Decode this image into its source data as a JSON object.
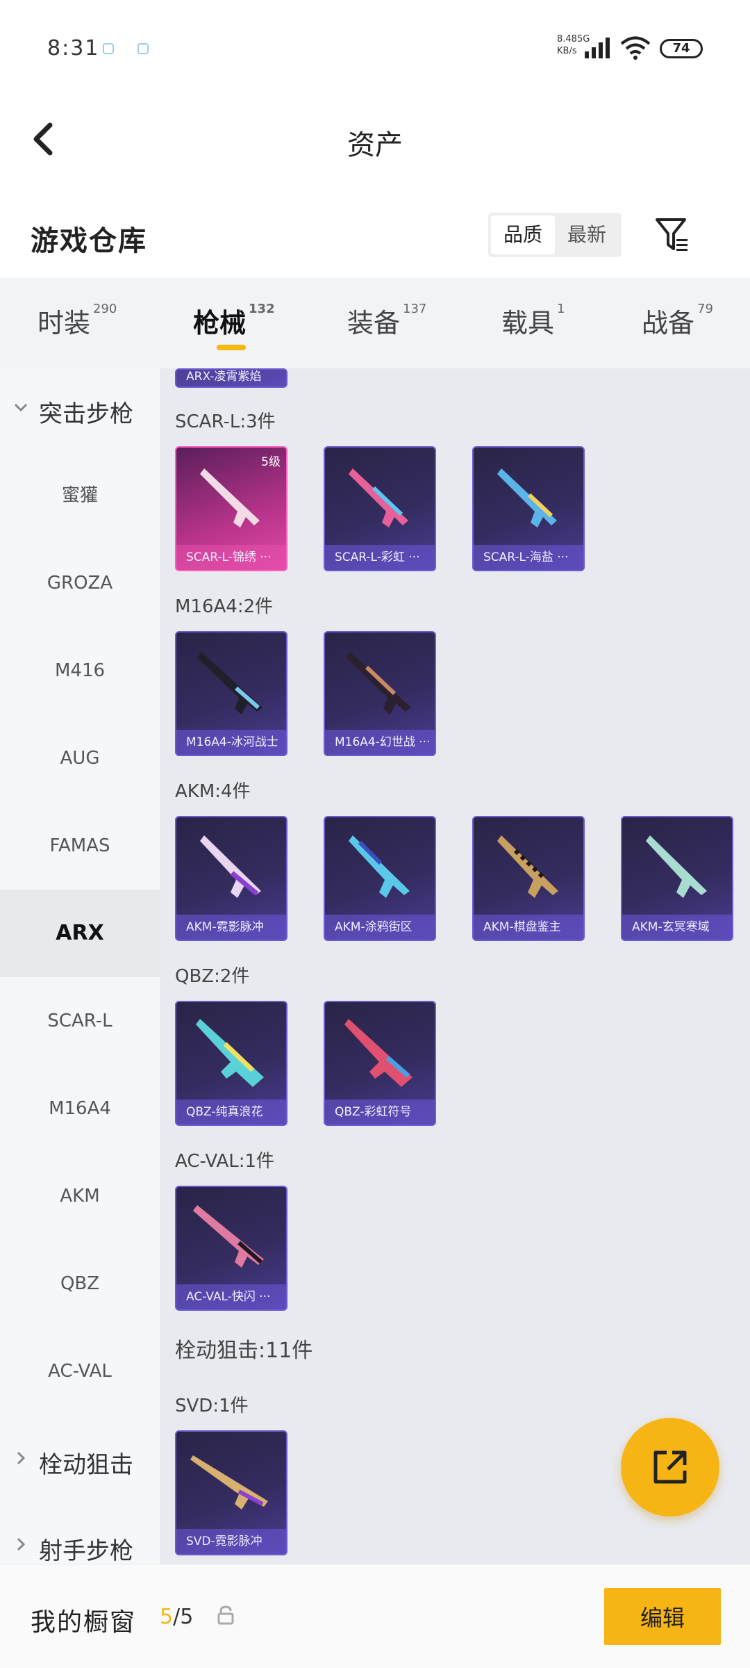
{
  "status": {
    "time": "8:31",
    "net_speed": "8.48",
    "net_unit": "KB/s",
    "net_type": "5G",
    "battery": "74"
  },
  "nav": {
    "title": "资产"
  },
  "warehouse": {
    "title": "游戏仓库",
    "sort_options": [
      "品质",
      "最新"
    ],
    "active_sort": "品质"
  },
  "tabs": [
    {
      "label": "时装",
      "count": "290"
    },
    {
      "label": "枪械",
      "count": "132"
    },
    {
      "label": "装备",
      "count": "137"
    },
    {
      "label": "载具",
      "count": "1"
    },
    {
      "label": "战备",
      "count": "79"
    }
  ],
  "sidebar": {
    "groups": [
      {
        "label": "突击步枪"
      },
      {
        "label": "栓动狙击"
      },
      {
        "label": "射手步枪"
      }
    ],
    "items": [
      "蜜獾",
      "GROZA",
      "M416",
      "AUG",
      "FAMAS",
      "ARX",
      "SCAR-L",
      "M16A4",
      "AKM",
      "QBZ",
      "AC-VAL"
    ]
  },
  "content": {
    "partial_top": "ARX-凌霄紫焰",
    "groups": [
      {
        "label": "SCAR-L:3件",
        "cards": [
          {
            "name": "SCAR-L-锦绣 ···",
            "level": "5级"
          },
          {
            "name": "SCAR-L-彩虹 ···",
            "level": ""
          },
          {
            "name": "SCAR-L-海盐 ···",
            "level": ""
          }
        ]
      },
      {
        "label": "M16A4:2件",
        "cards": [
          {
            "name": "M16A4-冰河战士"
          },
          {
            "name": "M16A4-幻世战 ···"
          }
        ]
      },
      {
        "label": "AKM:4件",
        "cards": [
          {
            "name": "AKM-霓影脉冲"
          },
          {
            "name": "AKM-涂鸦街区"
          },
          {
            "name": "AKM-棋盘鉴主"
          },
          {
            "name": "AKM-玄冥寒域"
          }
        ]
      },
      {
        "label": "QBZ:2件",
        "cards": [
          {
            "name": "QBZ-纯真浪花"
          },
          {
            "name": "QBZ-彩虹符号"
          }
        ]
      },
      {
        "label": "AC-VAL:1件",
        "cards": [
          {
            "name": "AC-VAL-快闪 ···"
          }
        ]
      }
    ],
    "section_label": "栓动狙击:11件",
    "svd": {
      "label": "SVD:1件",
      "card": "SVD-霓影脉冲"
    }
  },
  "bottom": {
    "title": "我的橱窗",
    "count_current": "5",
    "count_total": "/5",
    "edit_label": "编辑"
  },
  "colors": {
    "accent": "#f7b515",
    "card_purple": "#342c5f",
    "card_pink": "#b8348a"
  }
}
